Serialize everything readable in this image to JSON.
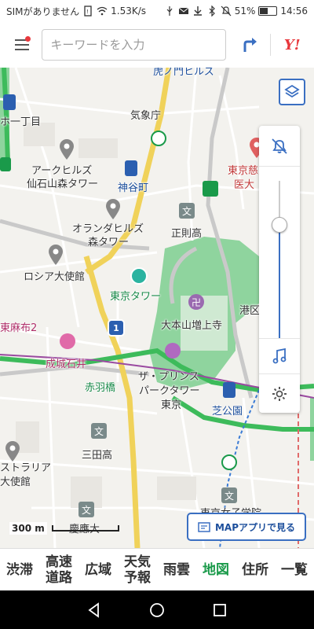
{
  "status_bar": {
    "carrier": "SIMがありません",
    "speed": "1.53K/s",
    "battery": "51%",
    "battery_level": 0.51,
    "time": "14:56"
  },
  "header": {
    "search_placeholder": "キーワードを入力",
    "logo": "Y!",
    "menu_has_notification": true
  },
  "map": {
    "labels": {
      "kasumigaseki": "虎ノ門ヒルズ",
      "kishocho": "気象庁",
      "ark_hills": "アークヒルズ",
      "sengokuyama": "仙石山森タワー",
      "kamiyacho": "神谷町",
      "oranda_hills": "オランダヒルズ",
      "mori_tower": "森タワー",
      "seisokuko": "正則高",
      "russia_embassy": "ロシア大使館",
      "tokyo_tower": "東京タワー",
      "higashi_azabu": "東麻布2",
      "zojoji": "大本山増上寺",
      "seiwa_ishii": "成城石井",
      "akabanebashi": "赤羽橋",
      "prince": "ザ・プリンス",
      "park_tower": "パークタワー",
      "tokyo": "東京",
      "shibakoen": "芝公園",
      "mita_high": "三田高",
      "australia": "ストラリア",
      "taishikan": "大使館",
      "itchome": "ホ一丁目",
      "jikei": "東京慈恵",
      "idai": "医大",
      "minatoku": "港区",
      "route_number": "1",
      "tokyo_kasei": "東京女子学院",
      "keio_u": "慶應大"
    }
  },
  "controls": {
    "zoom_level": 0.72
  },
  "scale": {
    "label": "300 m"
  },
  "map_app_button": {
    "label": "MAPアプリで見る"
  },
  "bottom_nav": {
    "items": [
      {
        "label": "渋滞",
        "active": false
      },
      {
        "label": "高速道路",
        "line1": "高速",
        "line2": "道路",
        "active": false
      },
      {
        "label": "広域",
        "active": false
      },
      {
        "label": "天気予報",
        "line1": "天気",
        "line2": "予報",
        "active": false
      },
      {
        "label": "雨雲",
        "active": false
      },
      {
        "label": "地図",
        "active": true
      },
      {
        "label": "住所",
        "active": false
      },
      {
        "label": "一覧",
        "active": false
      }
    ]
  },
  "colors": {
    "accent": "#3a6fc2",
    "active_nav": "#1a9a4a",
    "park": "#8fd49e",
    "brand_red": "#e8383d"
  }
}
